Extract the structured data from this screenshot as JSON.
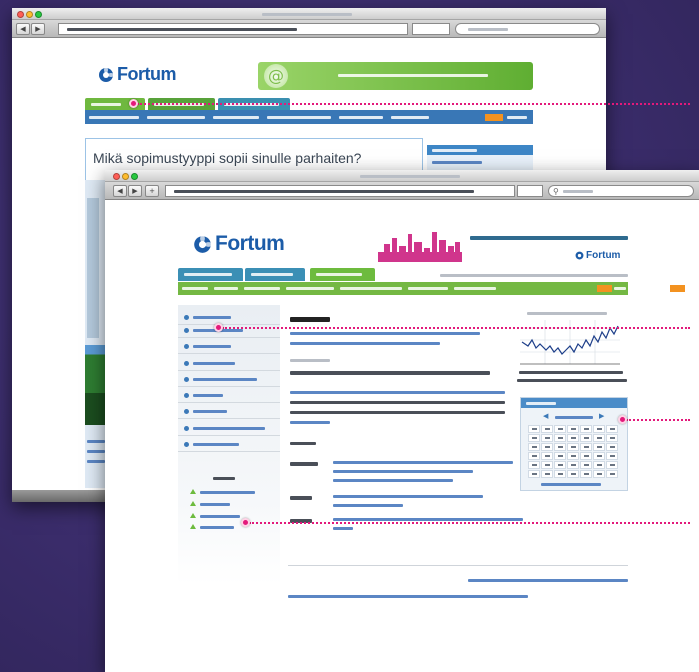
{
  "back_window": {
    "logo_text": "Fortum",
    "heading": "Mikä sopimustyyppi sopii sinulle parhaiten?"
  },
  "front_window": {
    "logo_text": "Fortum",
    "header_brand": "Fortum"
  },
  "icons": [
    "fortum-logo-icon",
    "at-sign-icon",
    "back-arrow-icon",
    "forward-arrow-icon",
    "search-icon",
    "city-skyline-icon",
    "bullet-icon",
    "triangle-icon",
    "prev-month-icon",
    "next-month-icon"
  ],
  "colors": {
    "background": "#3a2c6a",
    "brand_blue": "#1c5ca8",
    "nav_blue": "#3977b6",
    "nav_green": "#74b843",
    "orange_button": "#f39220",
    "skyline_pink": "#d0358c",
    "annotation": "#e3197b"
  }
}
